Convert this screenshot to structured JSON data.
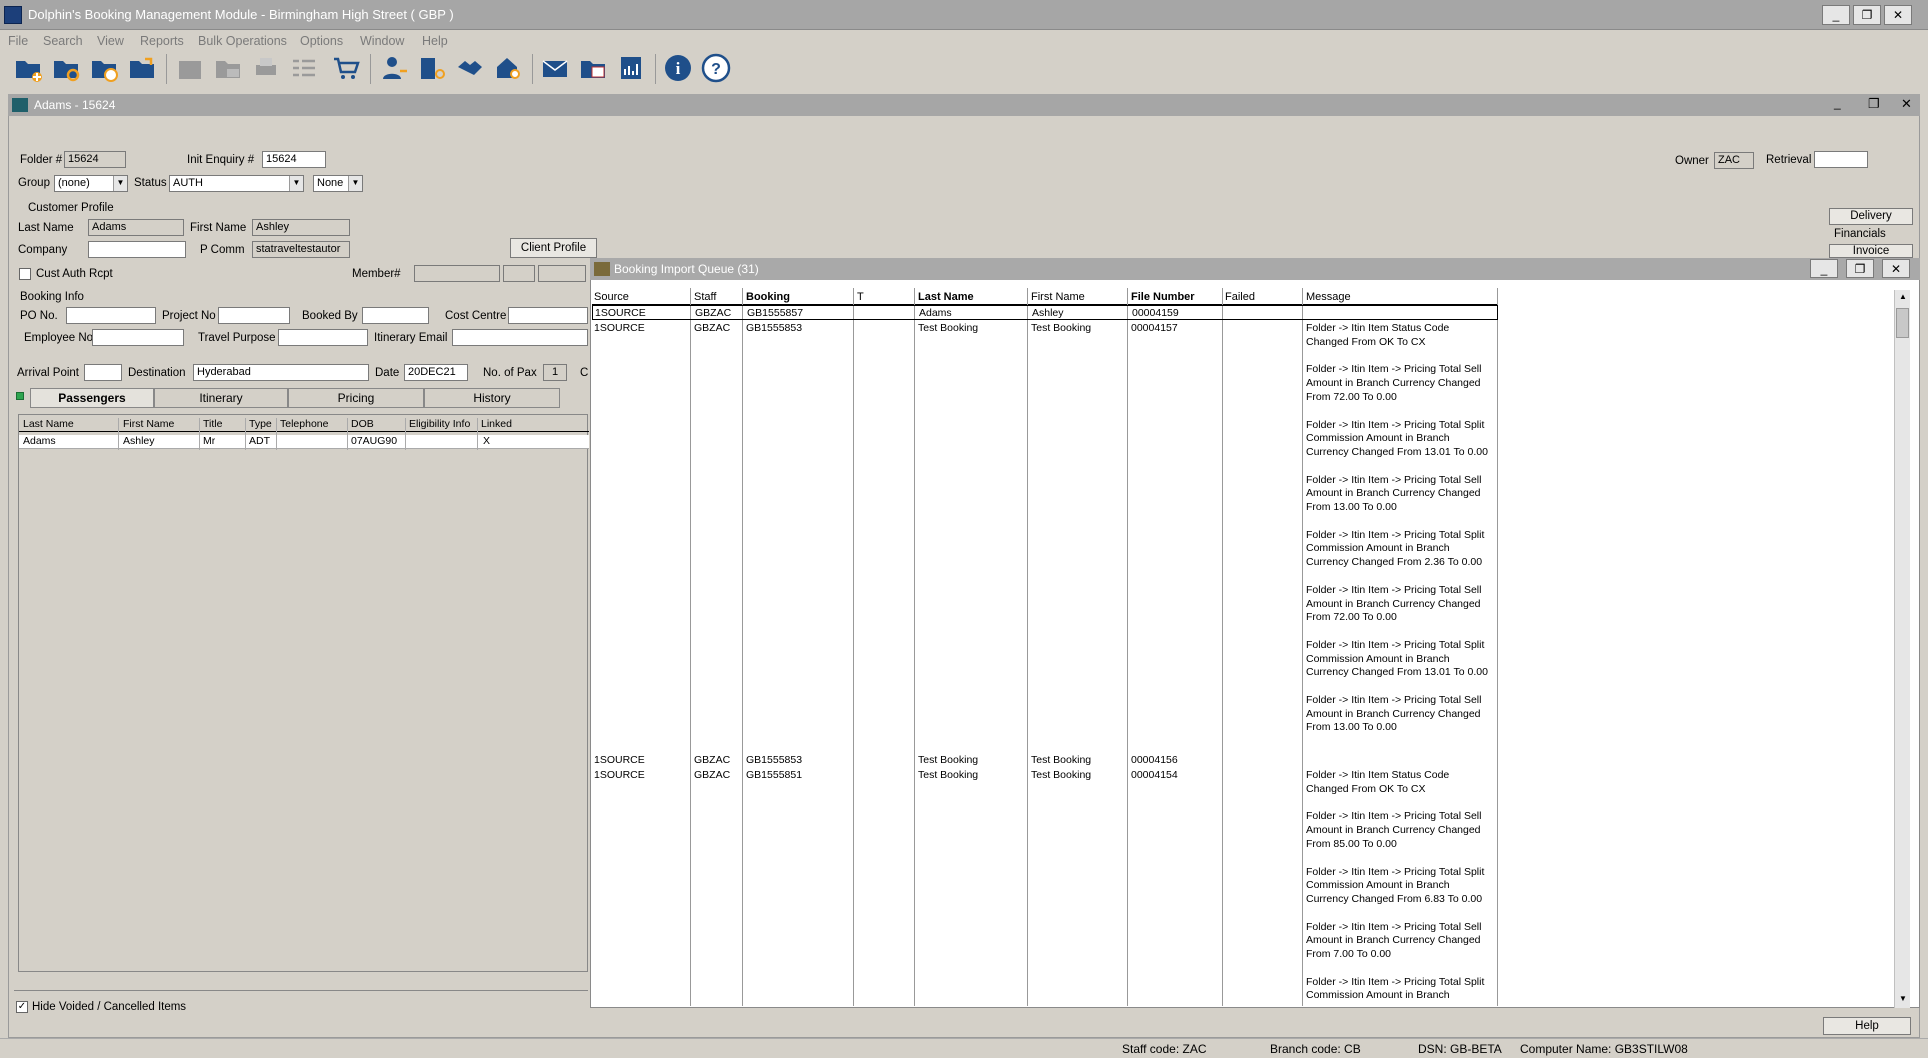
{
  "app": {
    "title": "Dolphin's Booking Management Module - Birmingham High Street ( GBP )",
    "win_minimize": "_",
    "win_restore": "❐",
    "win_close": "✕"
  },
  "menu": [
    "File",
    "Search",
    "View",
    "Reports",
    "Bulk Operations",
    "Options",
    "Window",
    "Help"
  ],
  "toolbar_icons": [
    "new-folder-icon",
    "search-folder-icon",
    "recent-folder-icon",
    "open-folder-icon",
    "folders-icon",
    "mail-folder-icon",
    "print-icon",
    "checklist-icon",
    "cart-icon",
    "customer-icon",
    "hotel-search-icon",
    "handshake-icon",
    "property-search-icon",
    "email-icon",
    "transfer-icon",
    "report-icon",
    "info-icon",
    "help-icon"
  ],
  "folder_window": {
    "title": "Adams - 15624",
    "folder_label": "Folder #",
    "folder_value": "15624",
    "init_enquiry_label": "Init Enquiry #",
    "init_enquiry_value": "15624",
    "owner_label": "Owner",
    "owner_value": "ZAC",
    "retrieval_label": "Retrieval",
    "retrieval_value": "",
    "group_label": "Group",
    "group_value": "(none)",
    "status_label": "Status",
    "status_value": "AUTH",
    "none_value": "None",
    "customer_profile_label": "Customer Profile",
    "last_name_label": "Last Name",
    "last_name_value": "Adams",
    "first_name_label": "First Name",
    "first_name_value": "Ashley",
    "company_label": "Company",
    "company_value": "",
    "pcomm_label": "P Comm",
    "pcomm_value": "statraveltestautor",
    "client_profile_button": "Client Profile",
    "cust_auth_label": "Cust Auth Rcpt",
    "member_label": "Member#",
    "booking_info_label": "Booking Info",
    "po_label": "PO No.",
    "project_label": "Project No",
    "booked_by_label": "Booked By",
    "cost_centre_label": "Cost Centre",
    "employee_label": "Employee No",
    "travel_purpose_label": "Travel Purpose",
    "itinerary_email_label": "Itinerary Email",
    "arrival_label": "Arrival Point",
    "destination_label": "Destination",
    "destination_value": "Hyderabad",
    "date_label": "Date",
    "date_value": "20DEC21",
    "pax_label": "No. of Pax",
    "pax_value": "1",
    "cut_label": "C",
    "tabs": [
      "Passengers",
      "Itinerary",
      "Pricing",
      "History"
    ],
    "pax_columns": [
      "Last Name",
      "First Name",
      "Title",
      "Type",
      "Telephone",
      "DOB",
      "Eligibility Info",
      "Linked"
    ],
    "pax_rows": [
      [
        "Adams",
        "Ashley",
        "Mr",
        "ADT",
        "",
        "07AUG90",
        "",
        "X"
      ]
    ],
    "hide_voided_label": "Hide Voided / Cancelled Items",
    "delivery_button": "Delivery",
    "financials_label": "Financials",
    "invoice_button": "Invoice",
    "help_button": "Help"
  },
  "queue": {
    "title": "Booking Import Queue (31)",
    "columns": [
      "Source",
      "Staff",
      "Booking",
      "T",
      "Last Name",
      "First Name",
      "File Number",
      "Failed",
      "Message"
    ],
    "rows": [
      {
        "source": "1SOURCE",
        "staff": "GBZAC",
        "booking": "GB1555857",
        "t": "",
        "last": "Adams",
        "first": "Ashley",
        "file": "00004159",
        "failed": "",
        "messages": []
      },
      {
        "source": "1SOURCE",
        "staff": "GBZAC",
        "booking": "GB1555853",
        "t": "",
        "last": "Test Booking",
        "first": "Test Booking",
        "file": "00004157",
        "failed": "",
        "messages": [
          "Folder -> Itin Item Status Code Changed From OK To CX",
          "Folder -> Itin Item -> Pricing Total Sell Amount in Branch Currency Changed From 72.00 To 0.00",
          "Folder -> Itin Item -> Pricing Total Split Commission Amount in Branch Currency Changed From 13.01 To 0.00",
          "Folder -> Itin Item -> Pricing Total Sell Amount in Branch Currency Changed From 13.00 To 0.00",
          "Folder -> Itin Item -> Pricing Total Split Commission Amount in Branch Currency Changed From 2.36 To 0.00",
          "Folder -> Itin Item -> Pricing Total Sell Amount in Branch Currency Changed From 72.00 To 0.00",
          "Folder -> Itin Item -> Pricing Total Split Commission Amount in Branch Currency Changed From 13.01 To 0.00",
          "Folder -> Itin Item -> Pricing Total Sell Amount in Branch Currency Changed From 13.00 To 0.00"
        ]
      },
      {
        "source": "1SOURCE",
        "staff": "GBZAC",
        "booking": "GB1555853",
        "t": "",
        "last": "Test Booking",
        "first": "Test Booking",
        "file": "00004156",
        "failed": "",
        "messages": []
      },
      {
        "source": "1SOURCE",
        "staff": "GBZAC",
        "booking": "GB1555851",
        "t": "",
        "last": "Test Booking",
        "first": "Test Booking",
        "file": "00004154",
        "failed": "",
        "messages": [
          "Folder -> Itin Item Status Code Changed From OK To CX",
          "Folder -> Itin Item -> Pricing Total Sell Amount in Branch Currency Changed From 85.00 To 0.00",
          "Folder -> Itin Item -> Pricing Total Split Commission Amount in Branch Currency Changed From 6.83 To 0.00",
          "Folder -> Itin Item -> Pricing Total Sell Amount in Branch Currency Changed From 7.00 To 0.00",
          "Folder -> Itin Item -> Pricing Total Split Commission Amount in Branch"
        ]
      }
    ]
  },
  "statusbar": {
    "staff": "Staff code: ZAC",
    "branch": "Branch code: CB",
    "dsn": "DSN: GB-BETA",
    "computer": "Computer Name: GB3STILW08"
  }
}
